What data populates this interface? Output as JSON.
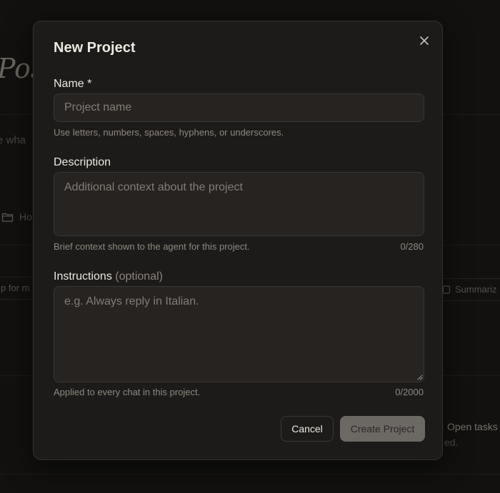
{
  "background": {
    "page_title_fragment": "Pos",
    "prompt_fragment": "e wha",
    "folder_fragment": "Ho",
    "chip_left_fragment": "p for m",
    "chip_right_fragment": "Summariz",
    "open_tasks_fragment": "Open tasks",
    "trailing_fragment": "ed."
  },
  "modal": {
    "title": "New Project",
    "name": {
      "label": "Name *",
      "placeholder": "Project name",
      "value": "",
      "hint": "Use letters, numbers, spaces, hyphens, or underscores."
    },
    "description": {
      "label": "Description",
      "placeholder": "Additional context about the project",
      "value": "",
      "hint": "Brief context shown to the agent for this project.",
      "counter": "0/280"
    },
    "instructions": {
      "label": "Instructions",
      "label_optional": "(optional)",
      "placeholder": "e.g. Always reply in Italian.",
      "value": "",
      "hint": "Applied to every chat in this project.",
      "counter": "0/2000"
    },
    "buttons": {
      "cancel": "Cancel",
      "create": "Create Project"
    }
  },
  "colors": {
    "backdrop": "#121110",
    "modal_bg": "#1d1b19",
    "input_bg": "#262321",
    "create_disabled_bg": "#6c6964"
  }
}
